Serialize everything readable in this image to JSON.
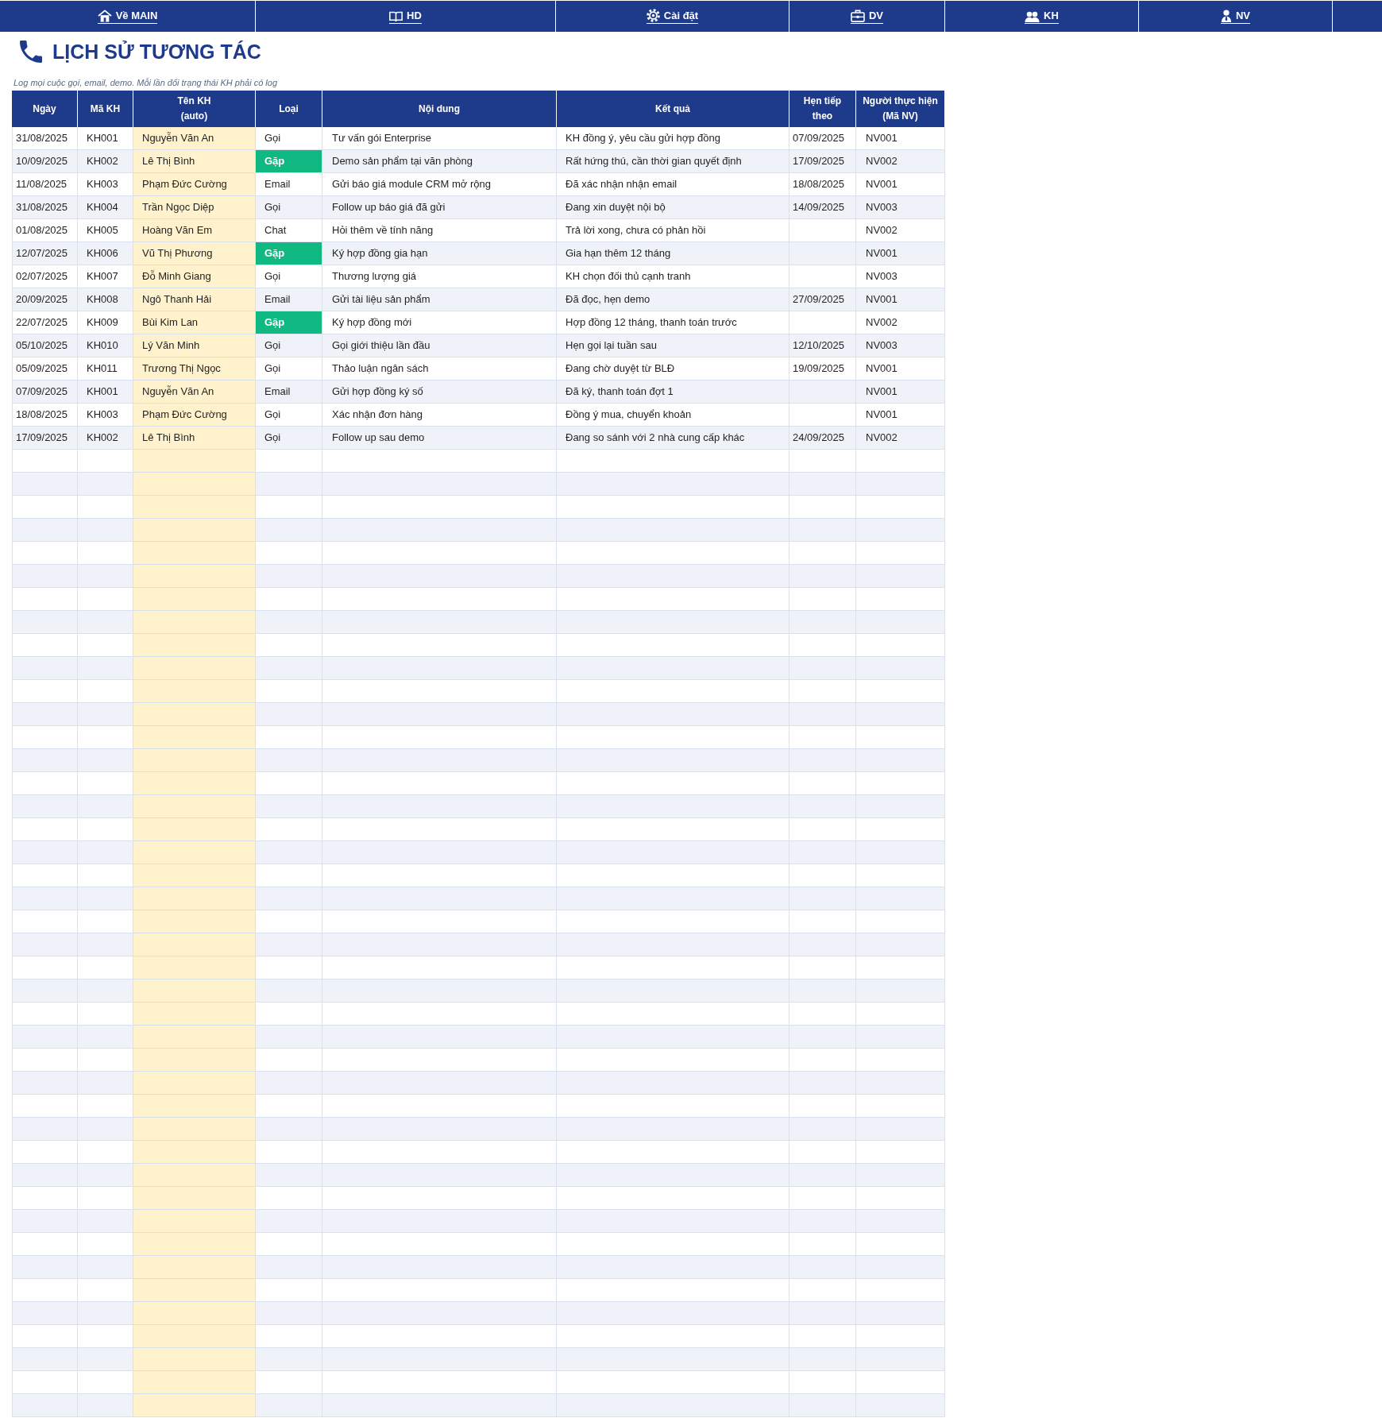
{
  "nav": [
    {
      "kind": "home",
      "label": "Về MAIN"
    },
    {
      "kind": "book",
      "label": "HD"
    },
    {
      "kind": "settings",
      "label": "Cài đặt"
    },
    {
      "kind": "briefcase",
      "label": "DV"
    },
    {
      "kind": "people",
      "label": "KH"
    },
    {
      "kind": "person",
      "label": "NV"
    }
  ],
  "title": "LỊCH SỬ TƯƠNG TÁC",
  "subtitle": "Log mọi cuộc gọi, email, demo. Mỗi lần đổi trạng thái KH phải có log",
  "table": {
    "columns": [
      "Ngày",
      "Mã KH",
      "Tên KH\n(auto)",
      "Loại",
      "Nội dung",
      "Kết quả",
      "Hẹn tiếp\ntheo",
      "Người thực hiện\n(Mã NV)"
    ],
    "rows": [
      {
        "date": "31/08/2025",
        "customer_id": "KH001",
        "customer_name": "Nguyễn Văn An",
        "type": "Gọi",
        "type_highlighted": false,
        "content": "Tư vấn gói Enterprise",
        "result": "KH đồng ý, yêu cầu gửi hợp đồng",
        "follow_up": "07/09/2025",
        "staff_id": "NV001"
      },
      {
        "date": "10/09/2025",
        "customer_id": "KH002",
        "customer_name": "Lê Thị Bình",
        "type": "Gặp",
        "type_highlighted": true,
        "content": "Demo sản phẩm tại văn phòng",
        "result": "Rất hứng thú, cần thời gian quyết định",
        "follow_up": "17/09/2025",
        "staff_id": "NV002"
      },
      {
        "date": "11/08/2025",
        "customer_id": "KH003",
        "customer_name": "Phạm Đức Cường",
        "type": "Email",
        "type_highlighted": false,
        "content": "Gửi báo giá module CRM mở rộng",
        "result": "Đã xác nhận nhận email",
        "follow_up": "18/08/2025",
        "staff_id": "NV001"
      },
      {
        "date": "31/08/2025",
        "customer_id": "KH004",
        "customer_name": "Trần Ngọc Diệp",
        "type": "Gọi",
        "type_highlighted": false,
        "content": "Follow up báo giá đã gửi",
        "result": "Đang xin duyệt nội bộ",
        "follow_up": "14/09/2025",
        "staff_id": "NV003"
      },
      {
        "date": "01/08/2025",
        "customer_id": "KH005",
        "customer_name": "Hoàng Văn Em",
        "type": "Chat",
        "type_highlighted": false,
        "content": "Hỏi thêm về tính năng",
        "result": "Trả lời xong, chưa có phản hồi",
        "staff_id": "NV002"
      },
      {
        "date": "12/07/2025",
        "customer_id": "KH006",
        "customer_name": "Vũ Thị Phương",
        "type": "Gặp",
        "type_highlighted": true,
        "content": "Ký hợp đồng gia hạn",
        "result": "Gia hạn thêm 12 tháng",
        "staff_id": "NV001"
      },
      {
        "date": "02/07/2025",
        "customer_id": "KH007",
        "customer_name": "Đỗ Minh Giang",
        "type": "Gọi",
        "type_highlighted": false,
        "content": "Thương lượng giá",
        "result": "KH chọn đối thủ cạnh tranh",
        "staff_id": "NV003"
      },
      {
        "date": "20/09/2025",
        "customer_id": "KH008",
        "customer_name": "Ngô Thanh Hải",
        "type": "Email",
        "type_highlighted": false,
        "content": "Gửi tài liệu sản phẩm",
        "result": "Đã đọc, hẹn demo",
        "follow_up": "27/09/2025",
        "staff_id": "NV001"
      },
      {
        "date": "22/07/2025",
        "customer_id": "KH009",
        "customer_name": "Bùi Kim Lan",
        "type": "Gặp",
        "type_highlighted": true,
        "content": "Ký hợp đồng mới",
        "result": "Hợp đồng 12 tháng, thanh toán trước",
        "staff_id": "NV002"
      },
      {
        "date": "05/10/2025",
        "customer_id": "KH010",
        "customer_name": "Lý Văn Minh",
        "type": "Gọi",
        "type_highlighted": false,
        "content": "Gọi giới thiệu lần đầu",
        "result": "Hẹn gọi lại tuần sau",
        "follow_up": "12/10/2025",
        "staff_id": "NV003"
      },
      {
        "date": "05/09/2025",
        "customer_id": "KH011",
        "customer_name": "Trương Thị Ngọc",
        "type": "Gọi",
        "type_highlighted": false,
        "content": "Thảo luận ngân sách",
        "result": "Đang chờ duyệt từ BLĐ",
        "follow_up": "19/09/2025",
        "staff_id": "NV001"
      },
      {
        "date": "07/09/2025",
        "customer_id": "KH001",
        "customer_name": "Nguyễn Văn An",
        "type": "Email",
        "type_highlighted": false,
        "content": "Gửi hợp đồng ký số",
        "result": "Đã ký, thanh toán đợt 1",
        "staff_id": "NV001"
      },
      {
        "date": "18/08/2025",
        "customer_id": "KH003",
        "customer_name": "Phạm Đức Cường",
        "type": "Gọi",
        "type_highlighted": false,
        "content": "Xác nhận đơn hàng",
        "result": "Đồng ý mua, chuyển khoản",
        "staff_id": "NV001"
      },
      {
        "date": "17/09/2025",
        "customer_id": "KH002",
        "customer_name": "Lê Thị Bình",
        "type": "Gọi",
        "type_highlighted": false,
        "content": "Follow up sau demo",
        "result": "Đang so sánh với 2 nhà cung cấp khác",
        "follow_up": "24/09/2025",
        "staff_id": "NV002"
      }
    ]
  }
}
